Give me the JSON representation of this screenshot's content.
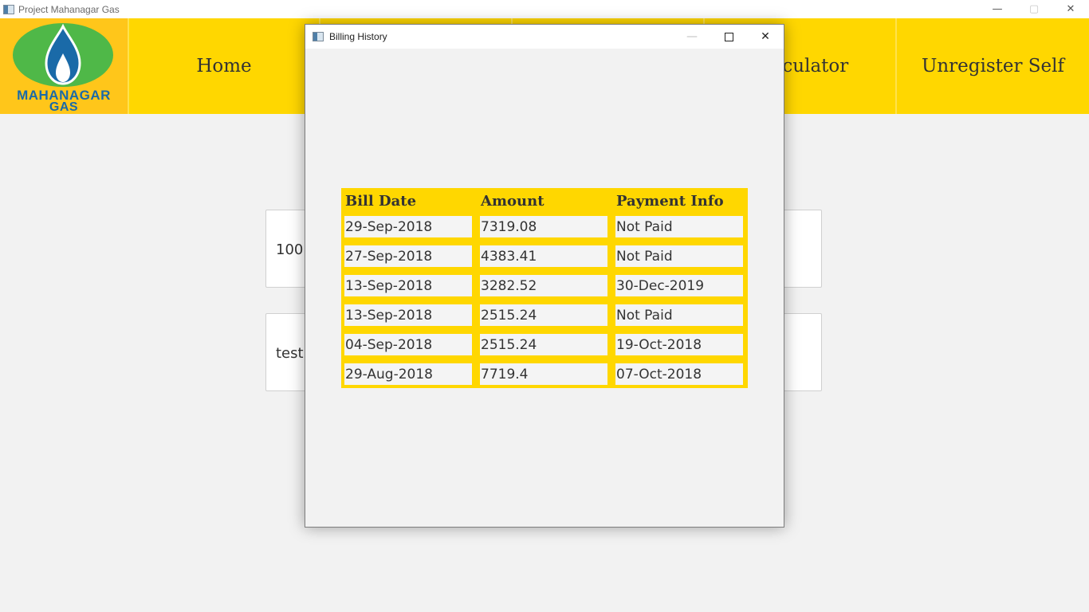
{
  "main_window": {
    "title": "Project Mahanagar Gas",
    "controls": {
      "minimize": "—",
      "maximize": "▢",
      "close": "✕"
    }
  },
  "logo": {
    "line1": "MAHANAGAR",
    "line2": "GAS"
  },
  "nav": {
    "items": [
      {
        "label": "Home"
      },
      {
        "label": "Calculator"
      },
      {
        "label": "Unregister Self"
      }
    ]
  },
  "cards": [
    {
      "text": "100"
    },
    {
      "text": "test"
    }
  ],
  "dialog": {
    "title": "Billing History",
    "controls": {
      "minimize": "—",
      "close": "✕"
    },
    "table": {
      "headers": [
        "Bill Date",
        "Amount",
        "Payment Info"
      ],
      "rows": [
        [
          "29-Sep-2018",
          "7319.08",
          "Not Paid"
        ],
        [
          "27-Sep-2018",
          "4383.41",
          "Not Paid"
        ],
        [
          "13-Sep-2018",
          "3282.52",
          "30-Dec-2019"
        ],
        [
          "13-Sep-2018",
          "2515.24",
          "Not Paid"
        ],
        [
          "04-Sep-2018",
          "2515.24",
          "19-Oct-2018"
        ],
        [
          "29-Aug-2018",
          "7719.4",
          "07-Oct-2018"
        ]
      ]
    }
  },
  "colors": {
    "nav_yellow": "#ffd700",
    "logo_blue": "#1a6aa8",
    "logo_green": "#4fb848"
  }
}
